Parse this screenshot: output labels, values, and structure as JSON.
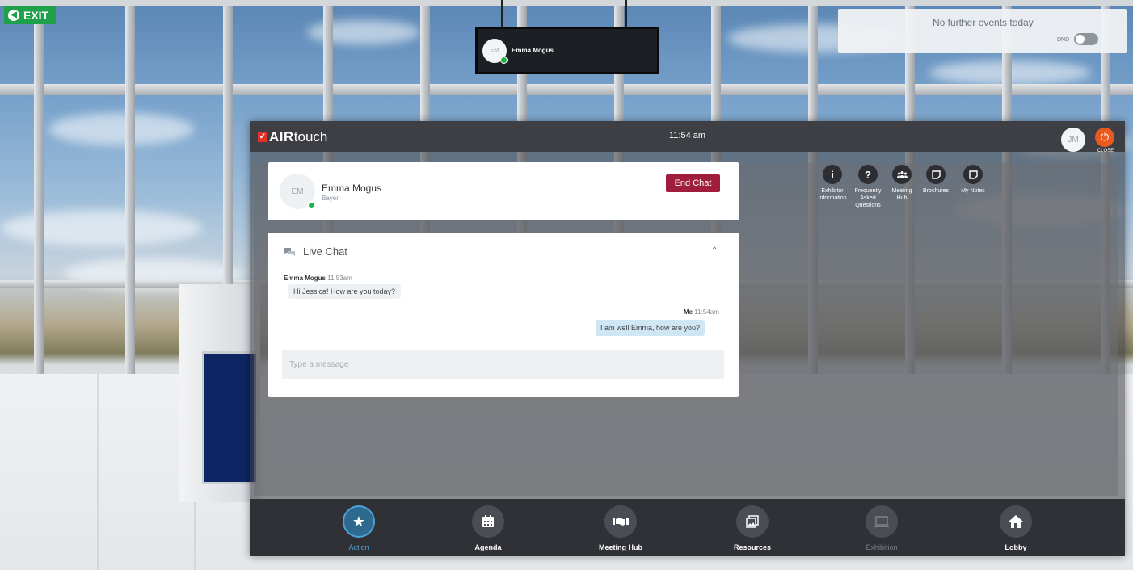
{
  "exit": {
    "label": "EXIT"
  },
  "hanging_sign": {
    "avatar_initials": "EM",
    "name": "Emma Mogus"
  },
  "notification": {
    "text": "No further events today",
    "dnd_label": "DND"
  },
  "header": {
    "logo_bold": "AIR",
    "logo_light": "touch",
    "time": "11:54 am",
    "user_initials": "JM",
    "close_label": "CLOSE"
  },
  "contact": {
    "initials": "EM",
    "name": "Emma Mogus",
    "company": "Bayer",
    "end_chat_label": "End Chat",
    "status_color": "#20b24c"
  },
  "chat": {
    "title": "Live Chat",
    "messages": [
      {
        "sender": "Emma Mogus",
        "time": "11:53am",
        "text": "Hi Jessica! How are you today?"
      },
      {
        "sender": "Me",
        "time": "11:54am",
        "text": "I am well Emma, how are you?"
      }
    ],
    "input_placeholder": "Type a message"
  },
  "actions": [
    {
      "icon": "info-icon",
      "label_lines": [
        "Exhibitor",
        "Information"
      ]
    },
    {
      "icon": "question-icon",
      "label_lines": [
        "Frequently",
        "Asked",
        "Questions"
      ]
    },
    {
      "icon": "group-icon",
      "label_lines": [
        "Meeting",
        "Hub"
      ]
    },
    {
      "icon": "note-icon",
      "label_lines": [
        "Brochures"
      ]
    },
    {
      "icon": "note-icon",
      "label_lines": [
        "My Notes"
      ]
    }
  ],
  "nav": [
    {
      "label": "Action",
      "icon": "star-icon",
      "state": "active"
    },
    {
      "label": "Agenda",
      "icon": "calendar-icon",
      "state": "normal"
    },
    {
      "label": "Meeting Hub",
      "icon": "handshake-icon",
      "state": "normal"
    },
    {
      "label": "Resources",
      "icon": "resources-icon",
      "state": "normal"
    },
    {
      "label": "Exhibition",
      "icon": "monitor-icon",
      "state": "disabled"
    },
    {
      "label": "Lobby",
      "icon": "home-icon",
      "state": "normal"
    }
  ],
  "colors": {
    "accent": "#4da3d8",
    "end_chat": "#a01e3c",
    "close": "#ea5a1e",
    "exit": "#1fa04a",
    "brand": "#e0312b"
  }
}
